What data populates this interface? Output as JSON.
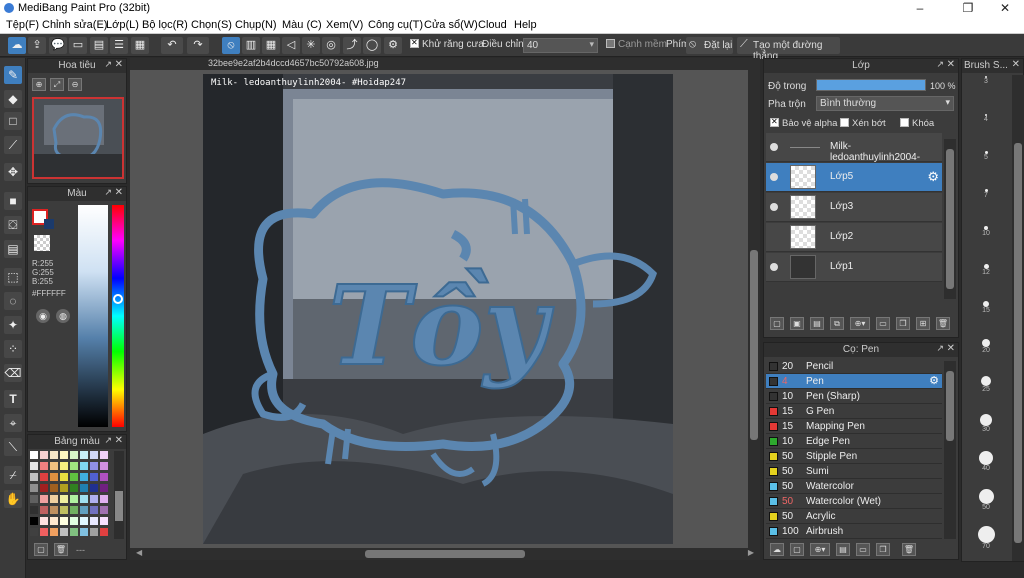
{
  "window": {
    "title": "MediBang Paint Pro (32bit)"
  },
  "menu": [
    "Tệp(F)",
    "Chỉnh sửa(E)",
    "Lớp(L)",
    "Bộ lọc(R)",
    "Chọn(S)",
    "Chụp(N)",
    "Màu (C)",
    "Xem(V)",
    "Công cụ(T)",
    "Cửa sổ(W)",
    "Cloud",
    "Help"
  ],
  "toolbar": {
    "antialias_label": "Khử răng cưa",
    "adjust_label": "Điều chỉnh",
    "adjust_value": "40",
    "soft_edge_label": "Cạnh mềm",
    "key_label": "Phím",
    "reset_label": "Đặt lại",
    "create_line_label": "Tạo một đường thẳng"
  },
  "navigator": {
    "title": "Hoa tiêu"
  },
  "color_panel": {
    "title": "Màu",
    "r": "R:255",
    "g": "G:255",
    "b": "B:255",
    "hex": "#FFFFFF"
  },
  "palette_panel": {
    "title": "Bảng màu",
    "footer": "---"
  },
  "document": {
    "tab": "32bee9e2af2b4dccd4657bc50792a608.jpg",
    "watermark": "Milk- ledoanthuylinh2004- #Hoidap247",
    "art_text": "Tồy"
  },
  "layer_panel": {
    "title": "Lớp",
    "opacity_label": "Độ trong",
    "opacity_value": "100 %",
    "opacity": 1.0,
    "blend_label": "Pha trộn",
    "blend_value": "Bình thường",
    "protect_alpha": "Bảo vệ alpha",
    "clipping": "Xén bớt",
    "lock": "Khóa",
    "layers": [
      {
        "name": "Milk- ledoanthuylinh2004-",
        "selected": false
      },
      {
        "name": "Lớp5",
        "selected": true
      },
      {
        "name": "Lớp3",
        "selected": false
      },
      {
        "name": "Lớp2",
        "selected": false
      },
      {
        "name": "Lớp1",
        "selected": false
      }
    ]
  },
  "brush_panel": {
    "title": "Cọ: Pen",
    "brushes": [
      {
        "size": "20",
        "name": "Pencil",
        "color": "#333333"
      },
      {
        "size": "4",
        "name": "Pen",
        "color": "#333333",
        "selected": true
      },
      {
        "size": "10",
        "name": "Pen (Sharp)",
        "color": "#333333"
      },
      {
        "size": "15",
        "name": "G Pen",
        "color": "#e53935"
      },
      {
        "size": "15",
        "name": "Mapping Pen",
        "color": "#e53935"
      },
      {
        "size": "10",
        "name": "Edge Pen",
        "color": "#2eaa2e"
      },
      {
        "size": "50",
        "name": "Stipple Pen",
        "color": "#e5d21e"
      },
      {
        "size": "50",
        "name": "Sumi",
        "color": "#e5d21e"
      },
      {
        "size": "50",
        "name": "Watercolor",
        "color": "#5bc0e8"
      },
      {
        "size": "50",
        "name": "Watercolor (Wet)",
        "color": "#5bc0e8"
      },
      {
        "size": "50",
        "name": "Acrylic",
        "color": "#e5d21e"
      },
      {
        "size": "100",
        "name": "Airbrush",
        "color": "#5bc0e8"
      }
    ]
  },
  "brush_size_panel": {
    "title": "Brush S...",
    "sizes": [
      "3",
      "4",
      "5",
      "7",
      "10",
      "12",
      "15",
      "20",
      "25",
      "30",
      "40",
      "50",
      "70"
    ]
  },
  "colors": {
    "accent": "#3f7fbf",
    "stroke": "#5b86b0"
  }
}
